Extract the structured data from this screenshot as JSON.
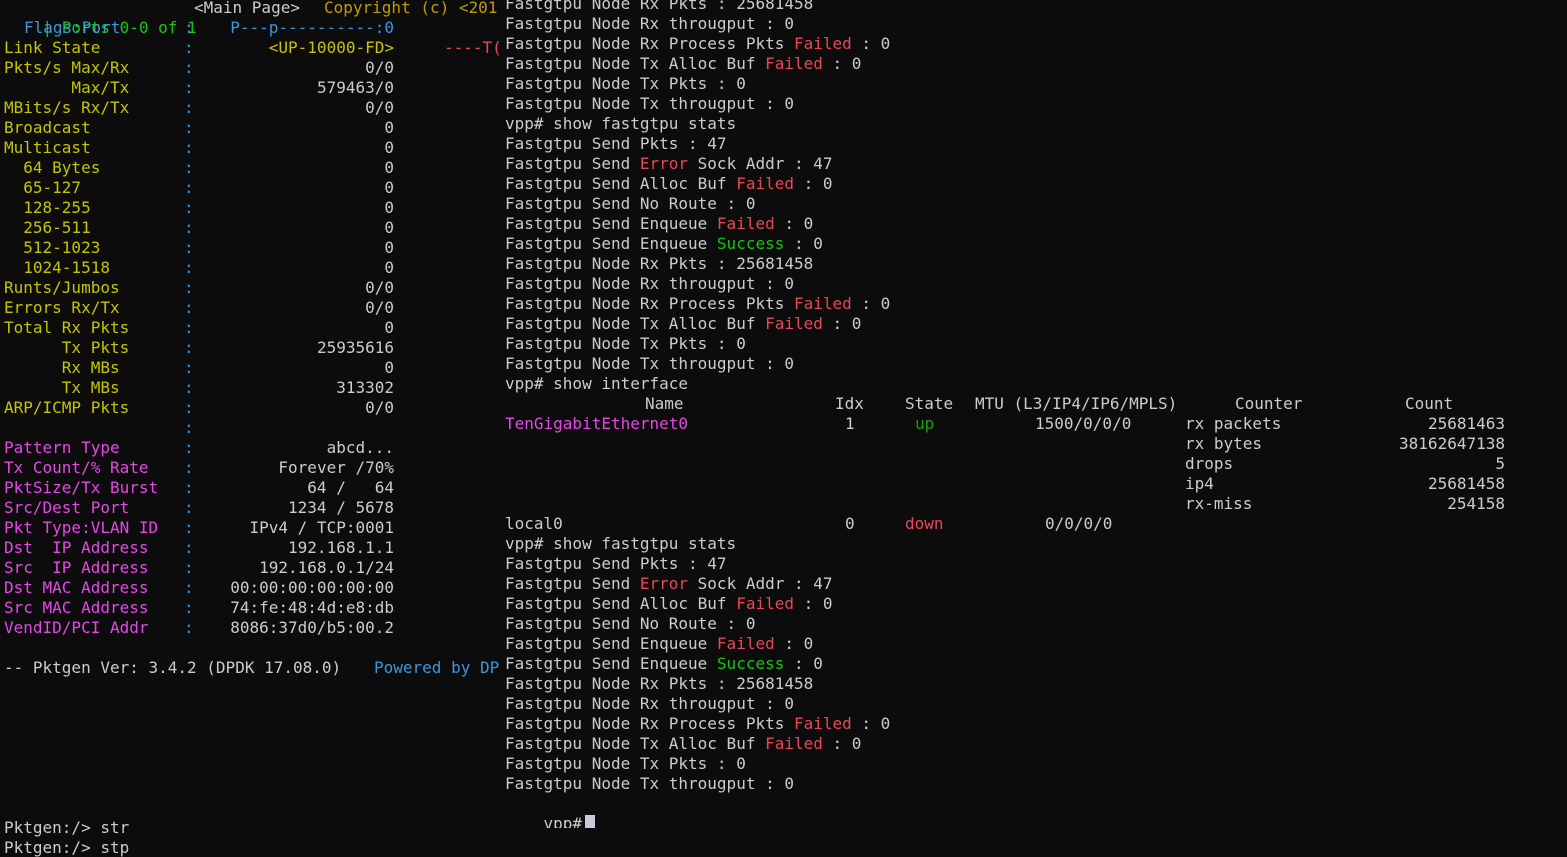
{
  "left": {
    "header": {
      "ports": "| Ports 0-0 of 1",
      "main_page": "<Main Page>",
      "copyright": "Copyright (c) <201"
    },
    "flags": {
      "label": "Flags:Port",
      "sep": ":",
      "value": "P---p----------:0"
    },
    "link_state": {
      "label": "Link State",
      "sep": ":",
      "value": "<UP-10000-FD>",
      "tail": "----T("
    },
    "stats": [
      {
        "label": "Pkts/s Max/Rx",
        "value": "0/0"
      },
      {
        "label": "       Max/Tx",
        "value": "579463/0"
      },
      {
        "label": "MBits/s Rx/Tx",
        "value": "0/0"
      },
      {
        "label": "Broadcast",
        "value": "0"
      },
      {
        "label": "Multicast",
        "value": "0"
      },
      {
        "label": "  64 Bytes",
        "value": "0"
      },
      {
        "label": "  65-127",
        "value": "0"
      },
      {
        "label": "  128-255",
        "value": "0"
      },
      {
        "label": "  256-511",
        "value": "0"
      },
      {
        "label": "  512-1023",
        "value": "0"
      },
      {
        "label": "  1024-1518",
        "value": "0"
      },
      {
        "label": "Runts/Jumbos",
        "value": "0/0"
      },
      {
        "label": "Errors Rx/Tx",
        "value": "0/0"
      },
      {
        "label": "Total Rx Pkts",
        "value": "0"
      },
      {
        "label": "      Tx Pkts",
        "value": "25935616"
      },
      {
        "label": "      Rx MBs",
        "value": "0"
      },
      {
        "label": "      Tx MBs",
        "value": "313302"
      },
      {
        "label": "ARP/ICMP Pkts",
        "value": "0/0"
      }
    ],
    "sep": ":",
    "config": [
      {
        "label": "Pattern Type",
        "value": "abcd..."
      },
      {
        "label": "Tx Count/% Rate",
        "value": "Forever /70%"
      },
      {
        "label": "PktSize/Tx Burst",
        "value": "64 /   64"
      },
      {
        "label": "Src/Dest Port",
        "value": "1234 / 5678"
      },
      {
        "label": "Pkt Type:VLAN ID",
        "value": "IPv4 / TCP:0001"
      },
      {
        "label": "Dst  IP Address",
        "value": "192.168.1.1"
      },
      {
        "label": "Src  IP Address",
        "value": "192.168.0.1/24"
      },
      {
        "label": "Dst MAC Address",
        "value": "00:00:00:00:00:00"
      },
      {
        "label": "Src MAC Address",
        "value": "74:fe:48:4d:e8:db"
      },
      {
        "label": "VendID/PCI Addr",
        "value": "8086:37d0/b5:00.2"
      }
    ],
    "footer_version": "-- Pktgen Ver: 3.4.2 (DPDK 17.08.0)",
    "footer_powered": "Powered by DP",
    "prompt_lines": [
      "Pktgen:/> str",
      "Pktgen:/> stp"
    ]
  },
  "right": {
    "lines": [
      {
        "pre": "Fastgtpu Node Rx Pkts : 25681458",
        "word": "",
        "post": ""
      },
      {
        "pre": "Fastgtpu Node Rx througput : 0",
        "word": "",
        "post": ""
      },
      {
        "pre": "Fastgtpu Node Rx Process Pkts ",
        "word": "Failed",
        "post": " : 0",
        "color": "red"
      },
      {
        "pre": "Fastgtpu Node Tx Alloc Buf ",
        "word": "Failed",
        "post": " : 0",
        "color": "red"
      },
      {
        "pre": "Fastgtpu Node Tx Pkts : 0",
        "word": "",
        "post": ""
      },
      {
        "pre": "Fastgtpu Node Tx througput : 0",
        "word": "",
        "post": ""
      },
      {
        "pre": "vpp# show fastgtpu stats",
        "word": "",
        "post": ""
      },
      {
        "pre": "Fastgtpu Send Pkts : 47",
        "word": "",
        "post": ""
      },
      {
        "pre": "Fastgtpu Send ",
        "word": "Error",
        "post": " Sock Addr : 47",
        "color": "red"
      },
      {
        "pre": "Fastgtpu Send Alloc Buf ",
        "word": "Failed",
        "post": " : 0",
        "color": "red"
      },
      {
        "pre": "Fastgtpu Send No Route : 0",
        "word": "",
        "post": ""
      },
      {
        "pre": "Fastgtpu Send Enqueue ",
        "word": "Failed",
        "post": " : 0",
        "color": "red"
      },
      {
        "pre": "Fastgtpu Send Enqueue ",
        "word": "Success",
        "post": " : 0",
        "color": "green"
      },
      {
        "pre": "Fastgtpu Node Rx Pkts : 25681458",
        "word": "",
        "post": ""
      },
      {
        "pre": "Fastgtpu Node Rx througput : 0",
        "word": "",
        "post": ""
      },
      {
        "pre": "Fastgtpu Node Rx Process Pkts ",
        "word": "Failed",
        "post": " : 0",
        "color": "red"
      },
      {
        "pre": "Fastgtpu Node Tx Alloc Buf ",
        "word": "Failed",
        "post": " : 0",
        "color": "red"
      },
      {
        "pre": "Fastgtpu Node Tx Pkts : 0",
        "word": "",
        "post": ""
      },
      {
        "pre": "Fastgtpu Node Tx througput : 0",
        "word": "",
        "post": ""
      },
      {
        "pre": "vpp# show interface",
        "word": "",
        "post": ""
      }
    ],
    "iface_header": {
      "name": "Name",
      "idx": "Idx",
      "state": "State",
      "mtu": "MTU (L3/IP4/IP6/MPLS)",
      "counter": "Counter",
      "count": "Count"
    },
    "iface_rows": [
      {
        "name": "TenGigabitEthernet0",
        "idx": "1",
        "state": "up",
        "mtu": "1500/0/0/0"
      },
      {
        "name": "local0",
        "idx": "0",
        "state": "down",
        "mtu": "0/0/0/0"
      }
    ],
    "counters": [
      {
        "name": "rx packets",
        "count": "25681463"
      },
      {
        "name": "rx bytes",
        "count": "38162647138"
      },
      {
        "name": "drops",
        "count": "5"
      },
      {
        "name": "ip4",
        "count": "25681458"
      },
      {
        "name": "rx-miss",
        "count": "254158"
      }
    ],
    "lines2": [
      {
        "pre": "vpp# show fastgtpu stats",
        "word": "",
        "post": ""
      },
      {
        "pre": "Fastgtpu Send Pkts : 47",
        "word": "",
        "post": ""
      },
      {
        "pre": "Fastgtpu Send ",
        "word": "Error",
        "post": " Sock Addr : 47",
        "color": "red"
      },
      {
        "pre": "Fastgtpu Send Alloc Buf ",
        "word": "Failed",
        "post": " : 0",
        "color": "red"
      },
      {
        "pre": "Fastgtpu Send No Route : 0",
        "word": "",
        "post": ""
      },
      {
        "pre": "Fastgtpu Send Enqueue ",
        "word": "Failed",
        "post": " : 0",
        "color": "red"
      },
      {
        "pre": "Fastgtpu Send Enqueue ",
        "word": "Success",
        "post": " : 0",
        "color": "green"
      },
      {
        "pre": "Fastgtpu Node Rx Pkts : 25681458",
        "word": "",
        "post": ""
      },
      {
        "pre": "Fastgtpu Node Rx througput : 0",
        "word": "",
        "post": ""
      },
      {
        "pre": "Fastgtpu Node Rx Process Pkts ",
        "word": "Failed",
        "post": " : 0",
        "color": "red"
      },
      {
        "pre": "Fastgtpu Node Tx Alloc Buf ",
        "word": "Failed",
        "post": " : 0",
        "color": "red"
      },
      {
        "pre": "Fastgtpu Node Tx Pkts : 0",
        "word": "",
        "post": ""
      },
      {
        "pre": "Fastgtpu Node Tx througput : 0",
        "word": "",
        "post": ""
      }
    ],
    "prompt": "vpp#"
  }
}
